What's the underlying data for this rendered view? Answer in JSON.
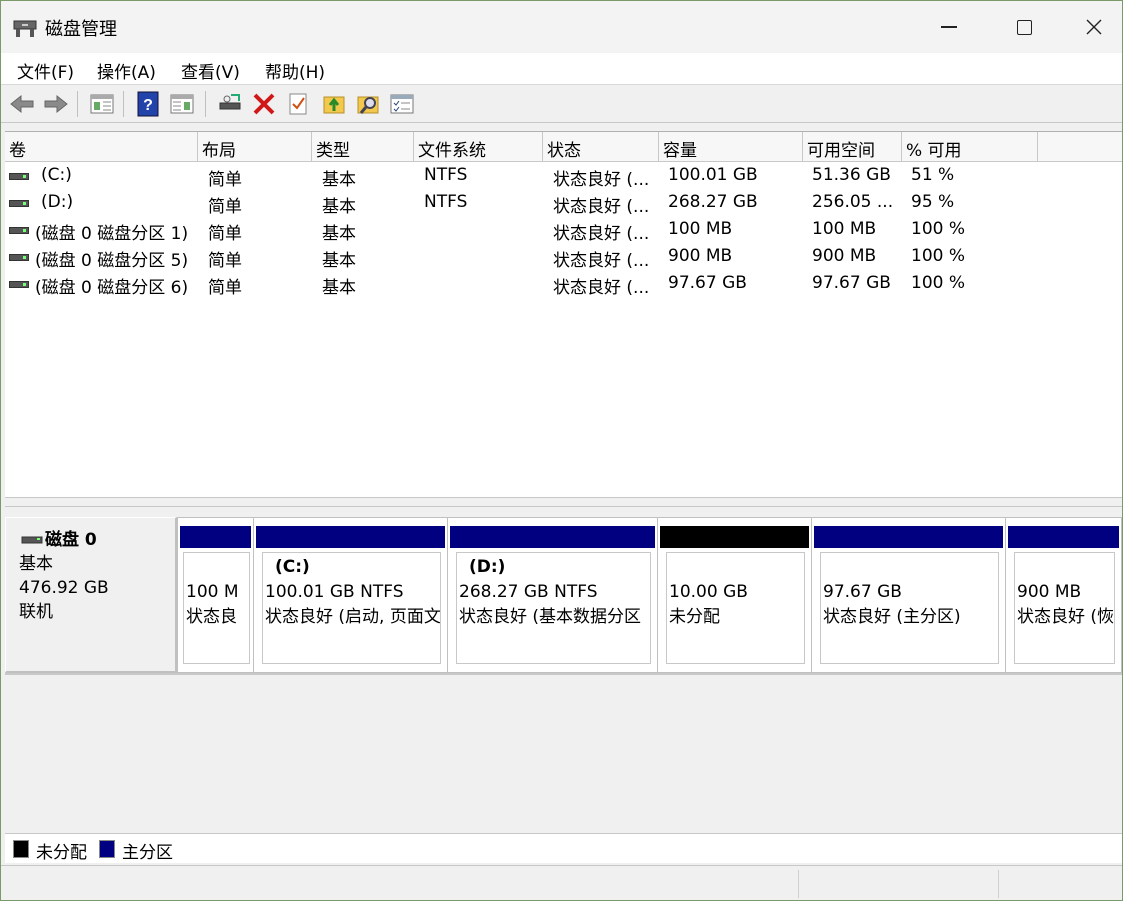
{
  "window": {
    "title": "磁盘管理"
  },
  "menu": [
    "文件(F)",
    "操作(A)",
    "查看(V)",
    "帮助(H)"
  ],
  "toolbar_icons": [
    "back-icon",
    "forward-icon",
    "console-tree-icon",
    "help-icon",
    "show-hide-icon",
    "connect-disk-icon",
    "delete-icon",
    "check-icon",
    "up-folder-icon",
    "search-folder-icon",
    "properties-icon"
  ],
  "columns": [
    "卷",
    "布局",
    "类型",
    "文件系统",
    "状态",
    "容量",
    "可用空间",
    "% 可用"
  ],
  "volumes": [
    {
      "name": "(C:)",
      "layout": "简单",
      "type": "基本",
      "fs": "NTFS",
      "status": "状态良好 (...",
      "capacity": "100.01 GB",
      "free": "51.36 GB",
      "pct": "51 %"
    },
    {
      "name": "(D:)",
      "layout": "简单",
      "type": "基本",
      "fs": "NTFS",
      "status": "状态良好 (...",
      "capacity": "268.27 GB",
      "free": "256.05 ...",
      "pct": "95 %"
    },
    {
      "name": "(磁盘 0 磁盘分区 1)",
      "layout": "简单",
      "type": "基本",
      "fs": "",
      "status": "状态良好 (...",
      "capacity": "100 MB",
      "free": "100 MB",
      "pct": "100 %"
    },
    {
      "name": "(磁盘 0 磁盘分区 5)",
      "layout": "简单",
      "type": "基本",
      "fs": "",
      "status": "状态良好 (...",
      "capacity": "900 MB",
      "free": "900 MB",
      "pct": "100 %"
    },
    {
      "name": "(磁盘 0 磁盘分区 6)",
      "layout": "简单",
      "type": "基本",
      "fs": "",
      "status": "状态良好 (...",
      "capacity": "97.67 GB",
      "free": "97.67 GB",
      "pct": "100 %"
    }
  ],
  "disk": {
    "name": "磁盘 0",
    "type": "基本",
    "size": "476.92 GB",
    "state": "联机"
  },
  "partitions": [
    {
      "name": "",
      "line1": "100 M",
      "line2": "状态良",
      "kind": "primary"
    },
    {
      "name": "(C:)",
      "line1": "100.01 GB NTFS",
      "line2": "状态良好 (启动, 页面文",
      "kind": "primary"
    },
    {
      "name": "(D:)",
      "line1": "268.27 GB NTFS",
      "line2": "状态良好 (基本数据分区",
      "kind": "primary"
    },
    {
      "name": "",
      "line1": "10.00 GB",
      "line2": "未分配",
      "kind": "unallocated"
    },
    {
      "name": "",
      "line1": "97.67 GB",
      "line2": "状态良好 (主分区)",
      "kind": "primary"
    },
    {
      "name": "",
      "line1": "900 MB",
      "line2": "状态良好 (恢",
      "kind": "primary"
    }
  ],
  "legend": [
    {
      "label": "未分配",
      "color": "#000000"
    },
    {
      "label": "主分区",
      "color": "#000080"
    }
  ],
  "colors": {
    "primary": "#000080",
    "unallocated": "#000000"
  }
}
